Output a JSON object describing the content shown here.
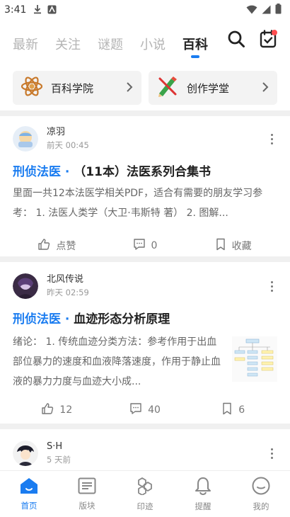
{
  "status_bar": {
    "time": "3:41"
  },
  "top_nav": {
    "tabs": [
      {
        "label": "最新"
      },
      {
        "label": "关注"
      },
      {
        "label": "谜题"
      },
      {
        "label": "小说"
      },
      {
        "label": "百科",
        "active": true
      }
    ]
  },
  "entries": [
    {
      "label": "百科学院",
      "icon": "atom-icon"
    },
    {
      "label": "创作学堂",
      "icon": "pencil-ruler-icon"
    }
  ],
  "posts": [
    {
      "author": "凉羽",
      "time": "前天 00:45",
      "category": "刑侦法医 · ",
      "title": "（11本）法医系列合集书",
      "excerpt": "里面一共12本法医学相关PDF，适合有需要的朋友学习参考：  1. 法医人类学（大卫·韦斯特 著） 2. 图解...",
      "likes": "点赞",
      "comments": "0",
      "favorites": "收藏"
    },
    {
      "author": "北风传说",
      "time": "昨天 02:59",
      "category": "刑侦法医 · ",
      "title": "血迹形态分析原理",
      "excerpt": "绪论：  1. 传统血迹分类方法：参考作用于出血部位暴力的速度和血液降落速度，作用于静止血液的暴力力度与血迹大小成...",
      "likes": "12",
      "comments": "40",
      "favorites": "6"
    },
    {
      "author": "S·H",
      "time": "5 天前"
    }
  ],
  "bottom_nav": [
    {
      "label": "首页",
      "icon": "home-icon",
      "active": true
    },
    {
      "label": "版块",
      "icon": "board-icon"
    },
    {
      "label": "印迹",
      "icon": "footprint-icon"
    },
    {
      "label": "提醒",
      "icon": "bell-icon"
    },
    {
      "label": "我的",
      "icon": "profile-icon"
    }
  ],
  "colors": {
    "accent": "#1a7cf0",
    "badge": "#ff4d4f"
  }
}
